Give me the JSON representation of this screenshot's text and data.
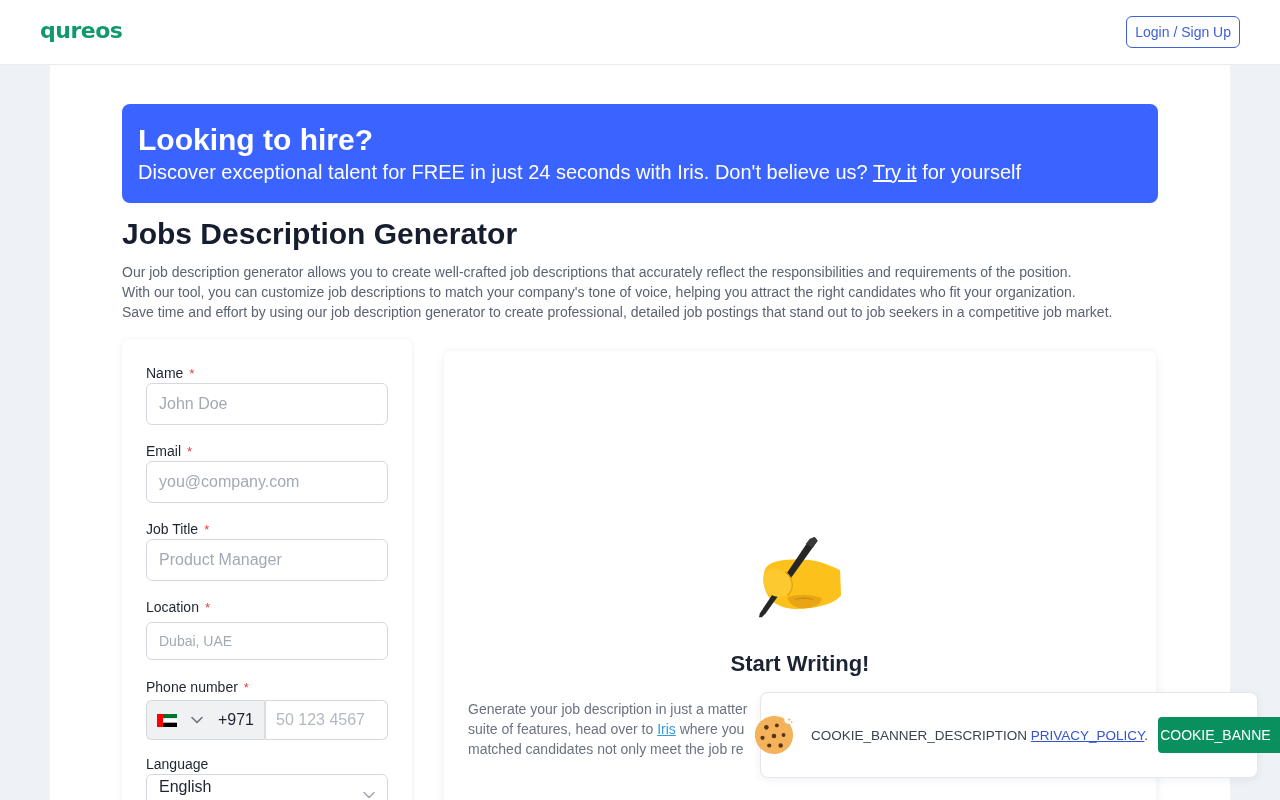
{
  "header": {
    "logo": "qureos",
    "login_button": "Login / Sign Up"
  },
  "hire_banner": {
    "title": "Looking to hire?",
    "text": "Discover exceptional talent for FREE in just 24 seconds with Iris. Don't believe us?",
    "link": "Try it",
    "text_after": "for yourself"
  },
  "title": "Jobs Description Generator",
  "description_lines": [
    "Our job description generator allows you to create well-crafted job descriptions that accurately reflect the responsibilities and requirements of the position.",
    "With our tool, you can customize job descriptions to match your company's tone of voice, helping you attract the right candidates who fit your organization.",
    "Save time and effort by using our job description generator to create professional, detailed job postings that stand out to job seekers in a competitive job market."
  ],
  "form": {
    "fields": [
      {
        "kind": "text",
        "label": "Name",
        "required_mark": "*",
        "placeholder": "John Doe"
      },
      {
        "kind": "text",
        "label": "Email",
        "required_mark": "*",
        "placeholder": "you@company.com"
      },
      {
        "kind": "text",
        "label": "Job Title",
        "required_mark": "*",
        "placeholder": "Product Manager"
      },
      {
        "kind": "place",
        "label": "Location",
        "required_mark": "*",
        "placeholder": "Dubai, UAE"
      },
      {
        "kind": "phone",
        "label": "Phone number",
        "required_mark": "*",
        "country_code": "+971",
        "placeholder": "50 123 4567"
      },
      {
        "kind": "select",
        "label": "Language",
        "value": "English"
      }
    ]
  },
  "preview": {
    "title": "Start Writing!",
    "line_1": "Generate your job description in just a matter",
    "line_2_before": "suite of features, head over to",
    "link": "Iris",
    "line_2_after": "where you",
    "line_3": "matched candidates not only meet the job re"
  },
  "cookie_banner": {
    "text": "COOKIE_BANNER_DESCRIPTION",
    "link": "PRIVACY_POLICY",
    "text_after": ".",
    "button": "COOKIE_BANNE"
  }
}
